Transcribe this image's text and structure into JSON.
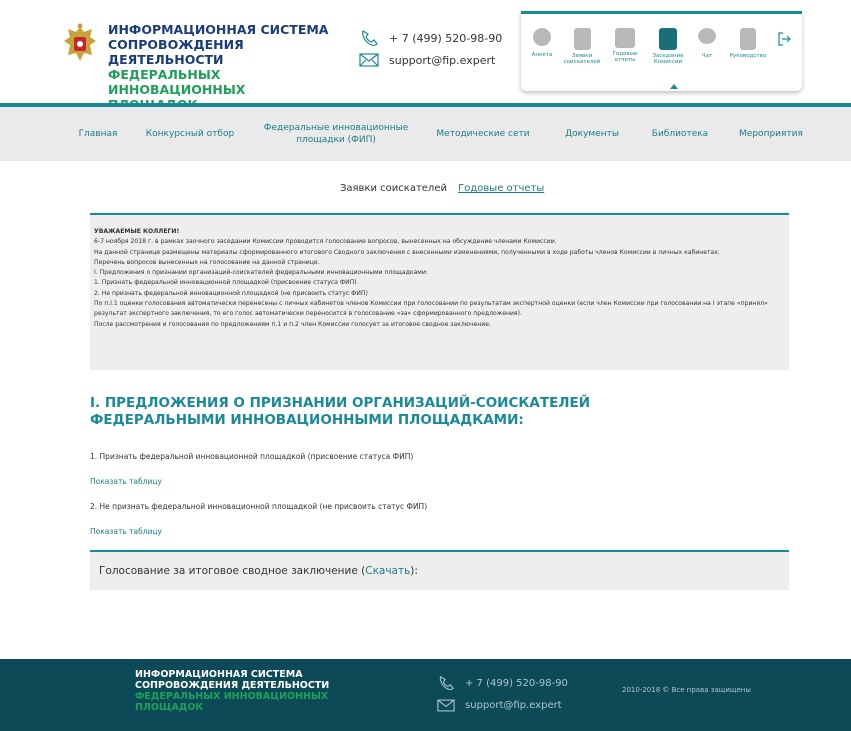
{
  "header": {
    "brand_line1": "ИНФОРМАЦИОННАЯ СИСТЕМА",
    "brand_line2": "СОПРОВОЖДЕНИЯ ДЕЯТЕЛЬНОСТИ",
    "brand_line3": "ФЕДЕРАЛЬНЫХ ИННОВАЦИОННЫХ",
    "brand_line4": "ПЛОЩАДОК",
    "phone": "+ 7 (499) 520-98-90",
    "email": "support@fip.expert",
    "emblem_icon": "coat-of-arms-icon"
  },
  "topbar": {
    "items": [
      {
        "label": "Анкета",
        "icon": "user-icon"
      },
      {
        "label": "Заявки соискателей",
        "icon": "document-icon"
      },
      {
        "label": "Годовые отчеты",
        "icon": "folder-icon"
      },
      {
        "label": "Заседание Комиссии",
        "icon": "commission-icon"
      },
      {
        "label": "Чат",
        "icon": "chat-icon"
      },
      {
        "label": "Руководство",
        "icon": "manual-icon"
      }
    ],
    "logout_icon": "logout-icon"
  },
  "nav": {
    "items": [
      "Главная",
      "Конкурсный отбор",
      "Федеральные инновационные площадки (ФИП)",
      "Методические сети",
      "Документы",
      "Библиотека",
      "Мероприятия"
    ]
  },
  "tabs": {
    "active": "Заявки соискателей",
    "link": "Годовые отчеты"
  },
  "notice": {
    "title": "УВАЖАЕМЫЕ КОЛЛЕГИ!",
    "lines": [
      "6-7 ноября 2018 г. в рамках заочного заседании Комиссии проводится голосование вопросов, вынесенных на обсуждение членами Комиссии.",
      "На данной странице размещены материалы сформированного итогового Сводного заключения с внесенными изменениями, полученными в ходе работы членов Комиссии в личных кабинетах.",
      "Перечень вопросов вынесенных на голосование на данной странице.",
      "I. Предложения о признании организаций-соискателей федеральными инновационными площадками:",
      "1. Признать федеральной инновационной площадкой (присвоение статуса ФИП)",
      "2. Не признать федеральной инновационной площадкой (не присвоить статус ФИП)",
      "По п.I.1 оценки голосования автоматически перенесены с личных кабинетов членов Комиссии при голосовании по результатам экспертной оценки (если член Комиссии при голосовании на I этапе «принял» результат экспертного заключения, то его голос автоматически переносится в голосование «за» сформированного предложения).",
      "После рассмотрения и голосования по предложениям п.1 и п.2 член Комиссии голосует за итоговое сводное заключение."
    ]
  },
  "main": {
    "heading": "I. ПРЕДЛОЖЕНИЯ О ПРИЗНАНИИ ОРГАНИЗАЦИЙ-СОИСКАТЕЛЕЙ ФЕДЕРАЛЬНЫМИ ИННОВАЦИОННЫМИ ПЛОЩАДКАМИ:",
    "item1": "1. Признать федеральной инновационной площадкой (присвоение статуса ФИП)",
    "show_table1": "Показать таблицу",
    "item2": "2. Не признать федеральной инновационной площадкой (не присвоить статус ФИП)",
    "show_table2": "Показать таблицу",
    "vote_prefix": "Голосование за итоговое сводное заключение (",
    "vote_link": "Скачать",
    "vote_suffix": "):"
  },
  "footer": {
    "brand_line1": "ИНФОРМАЦИОННАЯ СИСТЕМА",
    "brand_line2": "СОПРОВОЖДЕНИЯ ДЕЯТЕЛЬНОСТИ",
    "brand_line3": "ФЕДЕРАЛЬНЫХ ИННОВАЦИОННЫХ",
    "brand_line4": "ПЛОЩАДОК",
    "phone": "+ 7 (499) 520-98-90",
    "email": "support@fip.expert",
    "copyright": "2010-2018 © Все права защищены"
  },
  "colors": {
    "accent": "#1a8a98",
    "brand_blue": "#1b3c7a",
    "brand_green": "#1fa05a",
    "footer_bg": "#0d4a58"
  }
}
